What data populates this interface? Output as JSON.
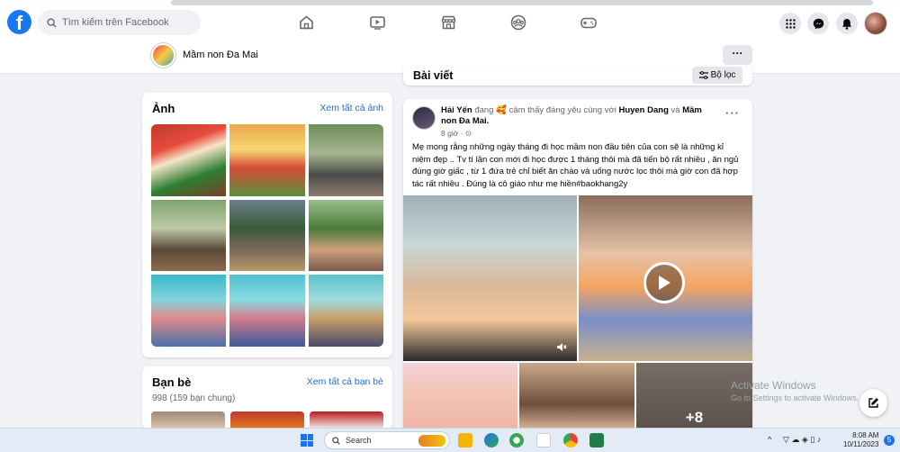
{
  "header": {
    "logo_letter": "f",
    "search_placeholder": "Tìm kiếm trên Facebook"
  },
  "page_bar": {
    "page_name": "Mầm non Đa Mai",
    "more_label": "···"
  },
  "photos_card": {
    "title": "Ảnh",
    "link": "Xem tất cả ảnh"
  },
  "friends_card": {
    "title": "Bạn bè",
    "link": "Xem tất cả bạn bè",
    "count": "998 (159 bạn chung)"
  },
  "posts_header": {
    "title": "Bài viết",
    "filter_label": "Bộ lọc"
  },
  "post": {
    "author": "Hải Yến",
    "feeling_text": "đang 🥰 cảm thấy đáng yêu cùng với",
    "tag1": "Huyen Dang",
    "and": "và",
    "tag2": "Mầm non Đa Mai.",
    "time": "8 giờ · ⊙",
    "more": "···",
    "text": "Mẹ mong rằng những ngày tháng đi học mầm non đầu tiên của con sẽ là những kỉ niệm đẹp .. Tv tí lần  con mới đi học được 1 tháng thôi mà đã tiến bộ rất nhiều , ăn ngủ đúng giờ giấc , từ 1 đứa trẻ chỉ biết ăn chào và uống nước lọc thôi mà giờ con đã hợp tác rất nhiều . Đúng là cô giáo như mẹ hiền#baokhang2y",
    "more_photos": "+8"
  },
  "watermark": {
    "line1": "Activate Windows",
    "line2": "Go to Settings to activate Windows."
  },
  "taskbar": {
    "search_label": "Search",
    "clock_time": "8:08 AM",
    "clock_date": "10/11/2023",
    "notification_count": "5",
    "lang": "^"
  },
  "colors": {
    "facebook_blue": "#1877f2",
    "link_blue": "#216fdb",
    "background": "#f0f2f5"
  }
}
